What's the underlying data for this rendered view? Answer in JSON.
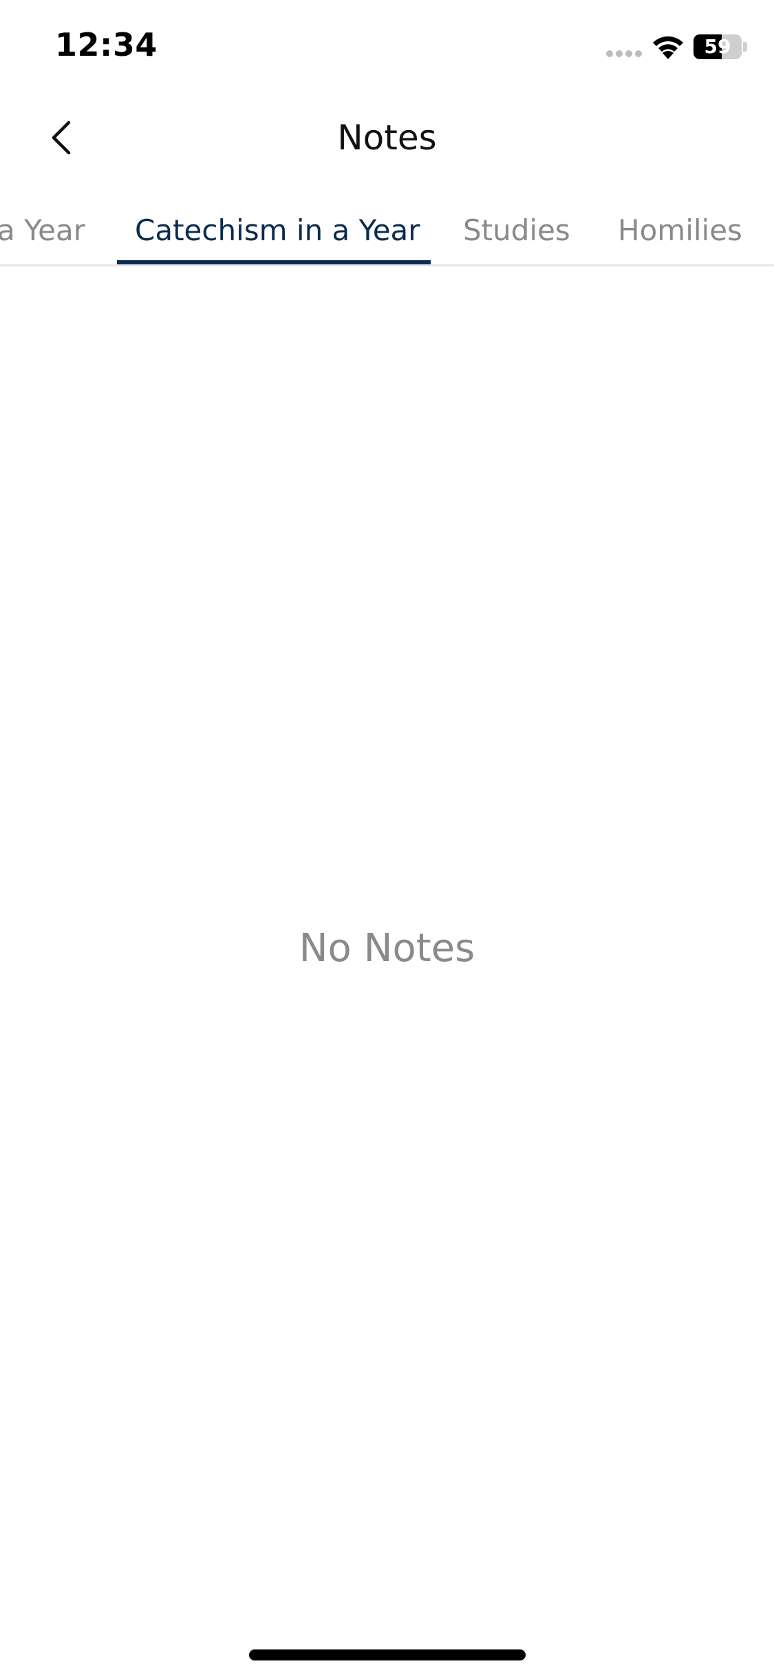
{
  "status_bar": {
    "time": "12:34",
    "battery_level": "59",
    "battery_percent": 59
  },
  "nav": {
    "title": "Notes",
    "back_icon": "chevron-left-icon"
  },
  "tabs": [
    {
      "label": "a Year",
      "active": false
    },
    {
      "label": "Catechism in a Year",
      "active": true
    },
    {
      "label": "Studies",
      "active": false
    },
    {
      "label": "Homilies",
      "active": false
    }
  ],
  "empty_state": {
    "message": "No Notes"
  },
  "colors": {
    "accent": "#0b2b4f",
    "inactive_text": "#8a8a8a",
    "divider": "#e6e6e6"
  }
}
